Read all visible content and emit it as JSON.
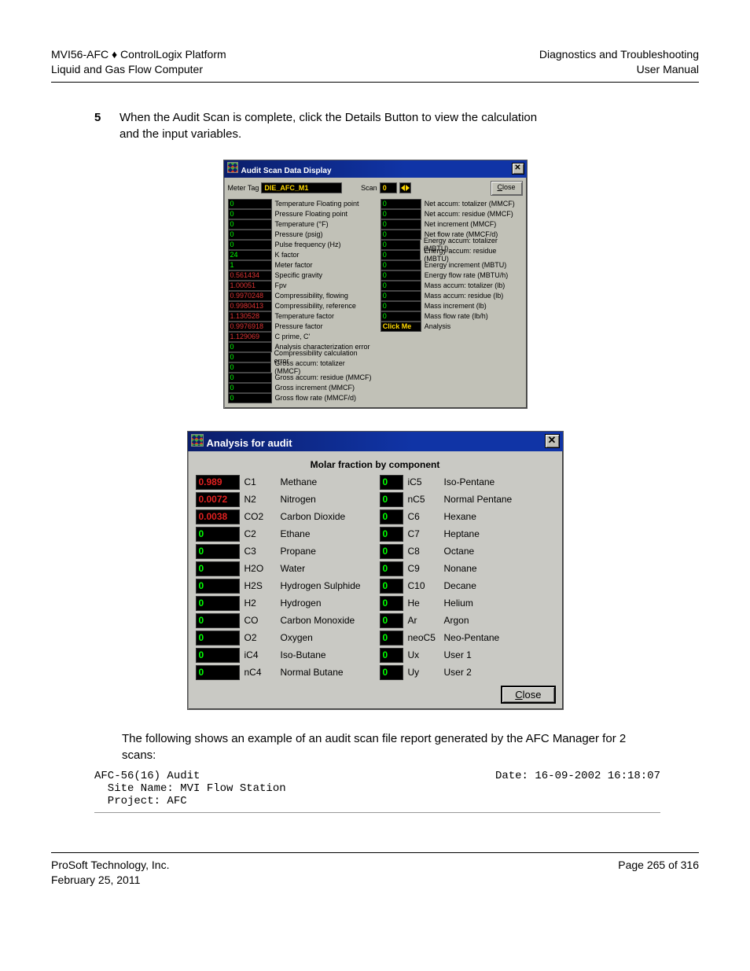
{
  "header": {
    "left1": "MVI56-AFC ♦ ControlLogix Platform",
    "left2": "Liquid and Gas Flow Computer",
    "right1": "Diagnostics and Troubleshooting",
    "right2": "User Manual"
  },
  "step": {
    "num": "5",
    "text": "When the Audit Scan is complete, click the Details Button to view the calculation and the input variables."
  },
  "dlg1": {
    "title": "Audit Scan Data Display",
    "meter_label": "Meter Tag",
    "meter_value": "DIE_AFC_M1",
    "scan_label": "Scan",
    "scan_value": "0",
    "close": "Close",
    "left": [
      {
        "v": "0",
        "n": "Temperature Floating point"
      },
      {
        "v": "0",
        "n": "Pressure Floating point"
      },
      {
        "v": "0",
        "n": "Temperature (°F)"
      },
      {
        "v": "0",
        "n": "Pressure (psig)"
      },
      {
        "v": "0",
        "n": "Pulse frequency (Hz)"
      },
      {
        "v": "24",
        "n": "K factor"
      },
      {
        "v": "1",
        "n": "Meter factor"
      },
      {
        "v": "0.561434",
        "n": "Specific gravity",
        "c": "red"
      },
      {
        "v": "1.00051",
        "n": "Fpv",
        "c": "red"
      },
      {
        "v": "0.9970248",
        "n": "Compressibility, flowing",
        "c": "red"
      },
      {
        "v": "0.9980413",
        "n": "Compressibility, reference",
        "c": "red"
      },
      {
        "v": "1.130528",
        "n": "Temperature factor",
        "c": "red"
      },
      {
        "v": "0.9976918",
        "n": "Pressure factor",
        "c": "red"
      },
      {
        "v": "1.129069",
        "n": "C prime, C'",
        "c": "red"
      },
      {
        "v": "0",
        "n": "Analysis characterization error"
      },
      {
        "v": "0",
        "n": "Compressibility calculation error"
      },
      {
        "v": "0",
        "n": "Gross accum: totalizer (MMCF)"
      },
      {
        "v": "0",
        "n": "Gross accum: residue (MMCF)"
      },
      {
        "v": "0",
        "n": "Gross increment (MMCF)"
      },
      {
        "v": "0",
        "n": "Gross flow rate (MMCF/d)"
      }
    ],
    "right": [
      {
        "v": "0",
        "n": "Net accum: totalizer (MMCF)"
      },
      {
        "v": "0",
        "n": "Net accum: residue (MMCF)"
      },
      {
        "v": "0",
        "n": "Net increment (MMCF)"
      },
      {
        "v": "0",
        "n": "Net flow rate (MMCF/d)"
      },
      {
        "v": "0",
        "n": "Energy accum: totalizer (MBTU)"
      },
      {
        "v": "0",
        "n": "Energy accum: residue (MBTU)"
      },
      {
        "v": "0",
        "n": "Energy increment (MBTU)"
      },
      {
        "v": "0",
        "n": "Energy flow rate (MBTU/h)"
      },
      {
        "v": "0",
        "n": "Mass accum: totalizer (lb)"
      },
      {
        "v": "0",
        "n": "Mass accum: residue (lb)"
      },
      {
        "v": "0",
        "n": "Mass increment (lb)"
      },
      {
        "v": "0",
        "n": "Mass flow rate (lb/h)"
      },
      {
        "v": "Click Me",
        "n": "Analysis",
        "c": "click"
      }
    ]
  },
  "dlg2": {
    "title": "Analysis for audit",
    "subtitle": "Molar fraction by component",
    "close": "Close",
    "rows": [
      {
        "v1": "0.989",
        "c1": "red",
        "s1": "C1",
        "n1": "Methane",
        "v2": "0",
        "s2": "iC5",
        "n2": "Iso-Pentane"
      },
      {
        "v1": "0.0072",
        "c1": "red",
        "s1": "N2",
        "n1": "Nitrogen",
        "v2": "0",
        "s2": "nC5",
        "n2": "Normal Pentane"
      },
      {
        "v1": "0.0038",
        "c1": "red",
        "s1": "CO2",
        "n1": "Carbon Dioxide",
        "v2": "0",
        "s2": "C6",
        "n2": "Hexane"
      },
      {
        "v1": "0",
        "s1": "C2",
        "n1": "Ethane",
        "v2": "0",
        "s2": "C7",
        "n2": "Heptane"
      },
      {
        "v1": "0",
        "s1": "C3",
        "n1": "Propane",
        "v2": "0",
        "s2": "C8",
        "n2": "Octane"
      },
      {
        "v1": "0",
        "s1": "H2O",
        "n1": "Water",
        "v2": "0",
        "s2": "C9",
        "n2": "Nonane"
      },
      {
        "v1": "0",
        "s1": "H2S",
        "n1": "Hydrogen Sulphide",
        "v2": "0",
        "s2": "C10",
        "n2": "Decane"
      },
      {
        "v1": "0",
        "s1": "H2",
        "n1": "Hydrogen",
        "v2": "0",
        "s2": "He",
        "n2": "Helium"
      },
      {
        "v1": "0",
        "s1": "CO",
        "n1": "Carbon Monoxide",
        "v2": "0",
        "s2": "Ar",
        "n2": "Argon"
      },
      {
        "v1": "0",
        "s1": "O2",
        "n1": "Oxygen",
        "v2": "0",
        "s2": "neoC5",
        "n2": "Neo-Pentane"
      },
      {
        "v1": "0",
        "s1": "iC4",
        "n1": "Iso-Butane",
        "v2": "0",
        "s2": "Ux",
        "n2": "User 1"
      },
      {
        "v1": "0",
        "s1": "nC4",
        "n1": "Normal Butane",
        "v2": "0",
        "s2": "Uy",
        "n2": "User 2"
      }
    ]
  },
  "para": "The following shows an example of an audit scan file report generated by the AFC Manager for 2 scans:",
  "report": {
    "left": "AFC-56(16) Audit",
    "right": "Date: 16-09-2002 16:18:07",
    "l2": "  Site Name: MVI Flow Station",
    "l3": "  Project: AFC"
  },
  "footer": {
    "left1": "ProSoft Technology, Inc.",
    "left2": "February 25, 2011",
    "right": "Page 265 of 316"
  }
}
